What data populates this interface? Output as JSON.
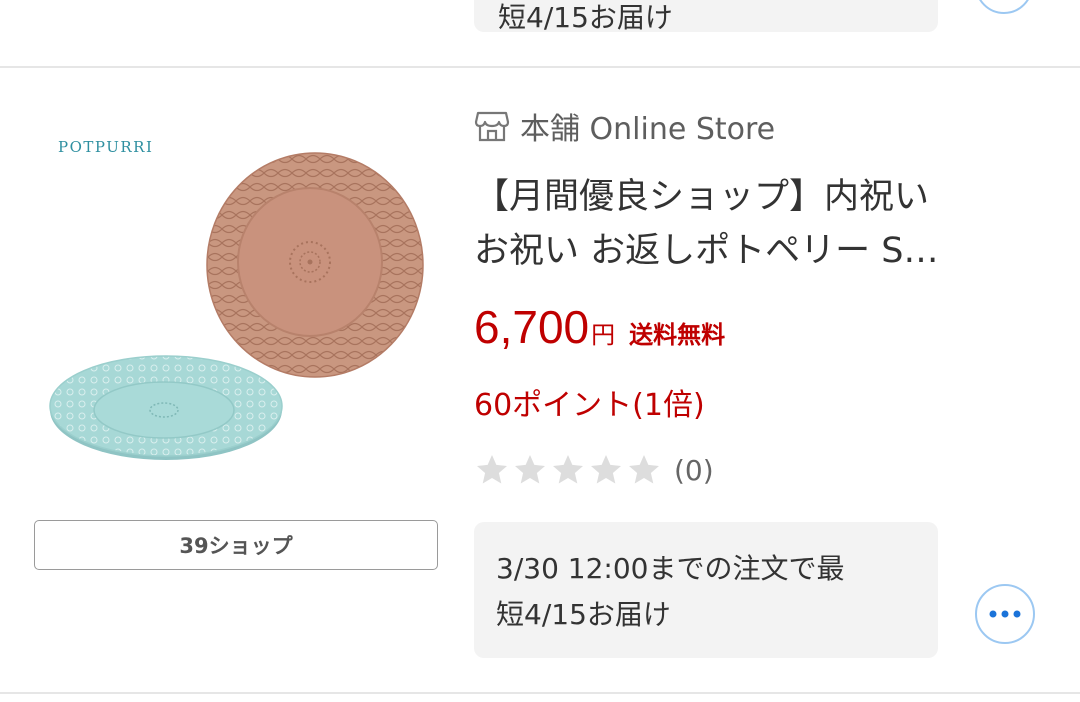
{
  "previous_item": {
    "delivery_text": "短4/15お届け"
  },
  "product": {
    "brand_logo_text": "POTPURRI",
    "shop_count_label": "39ショップ",
    "shop_icon": "store-icon",
    "shop_name": "本舗 Online Store",
    "title_line1": "【月間優良ショップ】内祝い",
    "title_line2": "お祝い お返しポトペリー S…",
    "price": "6,700",
    "price_unit": "円",
    "shipping": "送料無料",
    "points": "60ポイント(1倍)",
    "rating": 0,
    "rating_max": 5,
    "review_count": "(0)",
    "delivery_line1": "3/30 12:00までの注文で最",
    "delivery_line2": "短4/15お届け",
    "more_icon": "more-horizontal-icon"
  },
  "colors": {
    "price_red": "#bf0000",
    "star_empty": "#dddddd",
    "more_button_border": "#9cc8f2",
    "more_dots": "#1a73d9"
  }
}
